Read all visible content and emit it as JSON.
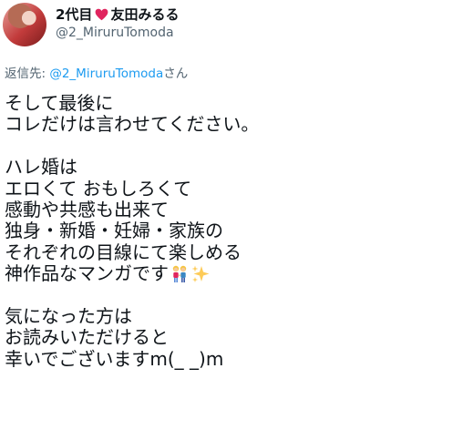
{
  "user": {
    "name_part1": "2代目",
    "name_part2": "友田みるる",
    "handle": "@2_MiruruTomoda"
  },
  "reply": {
    "prefix": "返信先: ",
    "handle": "@2_MiruruTomoda",
    "suffix": "さん"
  },
  "tweet": {
    "lines": [
      "そして最後に",
      "コレだけは言わせてください。",
      "",
      "ハレ婚は",
      "エロくて おもしろくて",
      "感動や共感も出来て",
      "独身・新婚・妊婦・家族の",
      "それぞれの目線にて楽しめる",
      "神作品なマンガです",
      "",
      "気になった方は",
      "お読みいただけると",
      "幸いでございますm(_ _)m"
    ]
  },
  "colors": {
    "text": "#0f1419",
    "secondary": "#536471",
    "link": "#1d9bf0",
    "heart": "#e0245e"
  },
  "icons": {
    "heart": "heart-icon",
    "couple": "couple-emoji-icon",
    "sparkles": "sparkles-icon"
  }
}
